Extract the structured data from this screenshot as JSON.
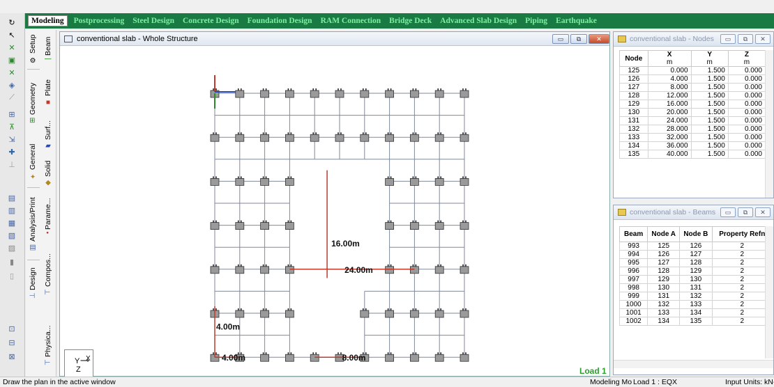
{
  "module_tabs": [
    {
      "label": "Modeling",
      "active": true
    },
    {
      "label": "Postprocessing",
      "active": false
    },
    {
      "label": "Steel Design",
      "active": false
    },
    {
      "label": "Concrete Design",
      "active": false
    },
    {
      "label": "Foundation Design",
      "active": false
    },
    {
      "label": "RAM Connection",
      "active": false
    },
    {
      "label": "Bridge Deck",
      "active": false
    },
    {
      "label": "Advanced Slab Design",
      "active": false
    },
    {
      "label": "Piping",
      "active": false
    },
    {
      "label": "Earthquake",
      "active": false
    }
  ],
  "page_control": {
    "groups": [
      {
        "label": "Setup"
      },
      {
        "label": "Geometry"
      },
      {
        "label": "General"
      },
      {
        "label": "Analysis/Print"
      },
      {
        "label": "Design"
      }
    ],
    "subtabs": [
      {
        "label": "Beam"
      },
      {
        "label": "Plate"
      },
      {
        "label": "Surf..."
      },
      {
        "label": "Solid"
      },
      {
        "label": "Parame..."
      },
      {
        "label": "Compos..."
      },
      {
        "label": "Physica..."
      }
    ]
  },
  "structure_window": {
    "title": "conventional slab - Whole Structure",
    "load_label": "Load 1",
    "dimensions": {
      "vertical_opening": "16.00m",
      "horizontal_opening": "24.00m",
      "left_spacing": "4.00m",
      "bottom_spacing": "4.00m",
      "bottom_gap": "8.00m"
    },
    "axis_labels": {
      "y": "Y",
      "x": "X",
      "z": "Z"
    }
  },
  "nodes_table": {
    "title": "conventional slab - Nodes",
    "headers": [
      "Node",
      "X",
      "Y",
      "Z"
    ],
    "units": [
      "",
      "m",
      "m",
      "m"
    ],
    "rows": [
      [
        "125",
        "0.000",
        "1.500",
        "0.000"
      ],
      [
        "126",
        "4.000",
        "1.500",
        "0.000"
      ],
      [
        "127",
        "8.000",
        "1.500",
        "0.000"
      ],
      [
        "128",
        "12.000",
        "1.500",
        "0.000"
      ],
      [
        "129",
        "16.000",
        "1.500",
        "0.000"
      ],
      [
        "130",
        "20.000",
        "1.500",
        "0.000"
      ],
      [
        "131",
        "24.000",
        "1.500",
        "0.000"
      ],
      [
        "132",
        "28.000",
        "1.500",
        "0.000"
      ],
      [
        "133",
        "32.000",
        "1.500",
        "0.000"
      ],
      [
        "134",
        "36.000",
        "1.500",
        "0.000"
      ],
      [
        "135",
        "40.000",
        "1.500",
        "0.000"
      ]
    ]
  },
  "beams_table": {
    "title": "conventional slab - Beams",
    "headers": [
      "Beam",
      "Node A",
      "Node B",
      "Property Refn"
    ],
    "rows": [
      [
        "993",
        "125",
        "126",
        "2"
      ],
      [
        "994",
        "126",
        "127",
        "2"
      ],
      [
        "995",
        "127",
        "128",
        "2"
      ],
      [
        "996",
        "128",
        "129",
        "2"
      ],
      [
        "997",
        "129",
        "130",
        "2"
      ],
      [
        "998",
        "130",
        "131",
        "2"
      ],
      [
        "999",
        "131",
        "132",
        "2"
      ],
      [
        "1000",
        "132",
        "133",
        "2"
      ],
      [
        "1001",
        "133",
        "134",
        "2"
      ],
      [
        "1002",
        "134",
        "135",
        "2"
      ]
    ]
  },
  "status_bar": {
    "hint": "Draw the plan in the active window",
    "mode": "Modeling Mo",
    "load": "Load 1 : EQX",
    "units": "Input Units:  kN-"
  },
  "colors": {
    "module_bar": "#1a7a44",
    "module_text": "#7cf0a0",
    "grid_line": "#7f8a99",
    "dimension": "#c0392b",
    "load_label": "#2aa02a"
  }
}
